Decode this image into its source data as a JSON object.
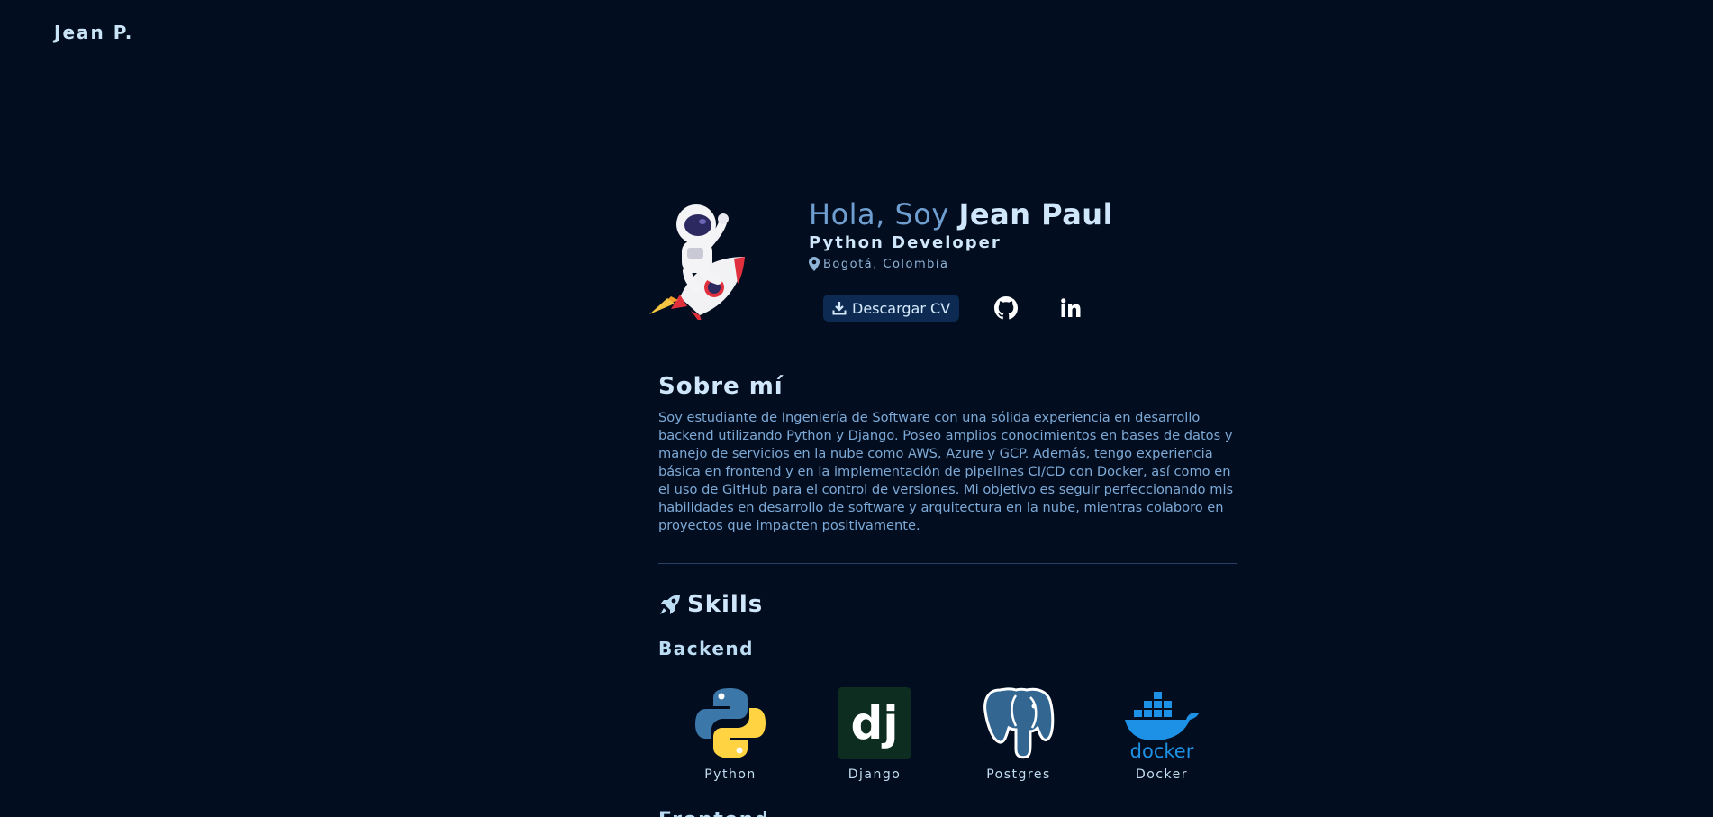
{
  "nav": {
    "brand": "Jean P."
  },
  "hero": {
    "greeting_prefix": "Hola, Soy ",
    "name": "Jean Paul",
    "role": "Python Developer",
    "location": "Bogotá, Colombia",
    "cv_button": "Descargar CV",
    "avatar_icon": "astronaut-rocket-icon",
    "social": [
      "github-icon",
      "linkedin-icon"
    ]
  },
  "about": {
    "title": "Sobre mí",
    "text": "Soy estudiante de Ingeniería de Software con una sólida experiencia en desarrollo backend utilizando Python y Django. Poseo amplios conocimientos en bases de datos y manejo de servicios en la nube como AWS, Azure y GCP. Además, tengo experiencia básica en frontend y en la implementación de pipelines CI/CD con Docker, así como en el uso de GitHub para el control de versiones. Mi objetivo es seguir perfeccionando mis habilidades en desarrollo de software y arquitectura en la nube, mientras colaboro en proyectos que impacten positivamente."
  },
  "skills": {
    "title": "Skills",
    "icon": "rocket-icon",
    "backend": {
      "title": "Backend",
      "items": [
        {
          "label": "Python",
          "icon": "python-icon"
        },
        {
          "label": "Django",
          "icon": "django-icon"
        },
        {
          "label": "Postgres",
          "icon": "postgres-icon"
        },
        {
          "label": "Docker",
          "icon": "docker-icon"
        }
      ]
    }
  },
  "colors": {
    "background": "#020d1f",
    "accent": "#0c2a52",
    "heading": "#cfe6fb",
    "muted": "#7da9d6"
  }
}
